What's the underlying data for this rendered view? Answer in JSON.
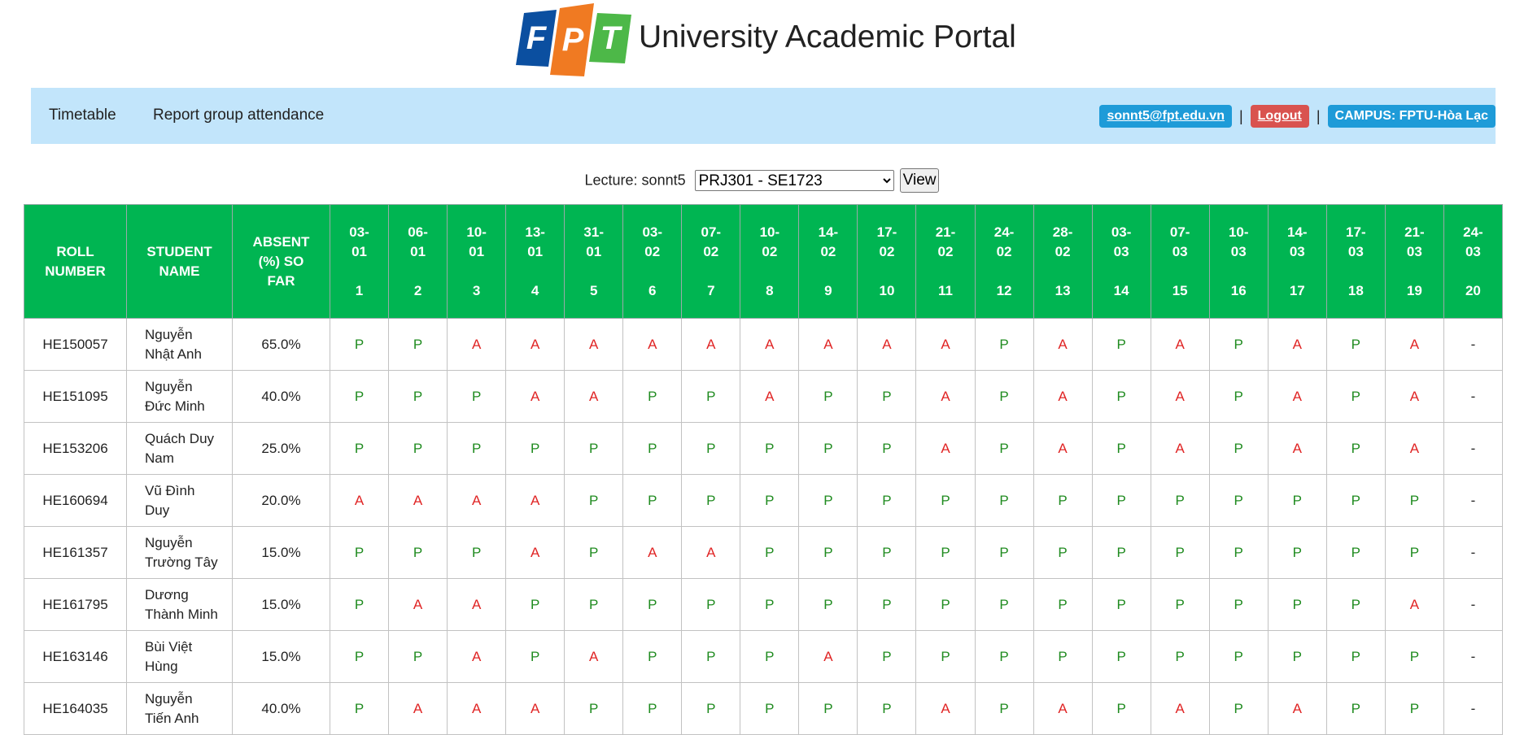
{
  "header": {
    "logo_text": "FPT",
    "title": "University Academic Portal"
  },
  "nav": {
    "timetable": "Timetable",
    "report": "Report group attendance",
    "email": "sonnt5@fpt.edu.vn",
    "separator": "|",
    "logout": "Logout",
    "campus": "CAMPUS: FPTU-Hòa Lạc"
  },
  "lecture_bar": {
    "label": "Lecture: sonnt5",
    "selected_course": "PRJ301 - SE1723",
    "view_button": "View"
  },
  "colors": {
    "present": "#1f8b1f",
    "absent": "#e02424",
    "header_bg": "#00b552",
    "nav_bg": "#c2e5fb"
  },
  "table": {
    "headers": {
      "roll": [
        "ROLL",
        "NUMBER"
      ],
      "student": [
        "STUDENT",
        "NAME"
      ],
      "absent": [
        "ABSENT",
        "(%) SO",
        "FAR"
      ]
    },
    "sessions": [
      {
        "date": [
          "03-",
          "01"
        ],
        "num": "1"
      },
      {
        "date": [
          "06-",
          "01"
        ],
        "num": "2"
      },
      {
        "date": [
          "10-",
          "01"
        ],
        "num": "3"
      },
      {
        "date": [
          "13-",
          "01"
        ],
        "num": "4"
      },
      {
        "date": [
          "31-",
          "01"
        ],
        "num": "5"
      },
      {
        "date": [
          "03-",
          "02"
        ],
        "num": "6"
      },
      {
        "date": [
          "07-",
          "02"
        ],
        "num": "7"
      },
      {
        "date": [
          "10-",
          "02"
        ],
        "num": "8"
      },
      {
        "date": [
          "14-",
          "02"
        ],
        "num": "9"
      },
      {
        "date": [
          "17-",
          "02"
        ],
        "num": "10"
      },
      {
        "date": [
          "21-",
          "02"
        ],
        "num": "11"
      },
      {
        "date": [
          "24-",
          "02"
        ],
        "num": "12"
      },
      {
        "date": [
          "28-",
          "02"
        ],
        "num": "13"
      },
      {
        "date": [
          "03-",
          "03"
        ],
        "num": "14"
      },
      {
        "date": [
          "07-",
          "03"
        ],
        "num": "15"
      },
      {
        "date": [
          "10-",
          "03"
        ],
        "num": "16"
      },
      {
        "date": [
          "14-",
          "03"
        ],
        "num": "17"
      },
      {
        "date": [
          "17-",
          "03"
        ],
        "num": "18"
      },
      {
        "date": [
          "21-",
          "03"
        ],
        "num": "19"
      },
      {
        "date": [
          "24-",
          "03"
        ],
        "num": "20"
      }
    ],
    "rows": [
      {
        "roll": "HE150057",
        "name": [
          "Nguyễn",
          "Nhật Anh"
        ],
        "absent": "65.0%",
        "att": [
          "P",
          "P",
          "A",
          "A",
          "A",
          "A",
          "A",
          "A",
          "A",
          "A",
          "A",
          "P",
          "A",
          "P",
          "A",
          "P",
          "A",
          "P",
          "A",
          "-"
        ]
      },
      {
        "roll": "HE151095",
        "name": [
          "Nguyễn",
          "Đức Minh"
        ],
        "absent": "40.0%",
        "att": [
          "P",
          "P",
          "P",
          "A",
          "A",
          "P",
          "P",
          "A",
          "P",
          "P",
          "A",
          "P",
          "A",
          "P",
          "A",
          "P",
          "A",
          "P",
          "A",
          "-"
        ]
      },
      {
        "roll": "HE153206",
        "name": [
          "Quách Duy",
          "Nam"
        ],
        "absent": "25.0%",
        "att": [
          "P",
          "P",
          "P",
          "P",
          "P",
          "P",
          "P",
          "P",
          "P",
          "P",
          "A",
          "P",
          "A",
          "P",
          "A",
          "P",
          "A",
          "P",
          "A",
          "-"
        ]
      },
      {
        "roll": "HE160694",
        "name": [
          "Vũ Đình",
          "Duy"
        ],
        "absent": "20.0%",
        "att": [
          "A",
          "A",
          "A",
          "A",
          "P",
          "P",
          "P",
          "P",
          "P",
          "P",
          "P",
          "P",
          "P",
          "P",
          "P",
          "P",
          "P",
          "P",
          "P",
          "-"
        ]
      },
      {
        "roll": "HE161357",
        "name": [
          "Nguyễn",
          "Trường Tây"
        ],
        "absent": "15.0%",
        "att": [
          "P",
          "P",
          "P",
          "A",
          "P",
          "A",
          "A",
          "P",
          "P",
          "P",
          "P",
          "P",
          "P",
          "P",
          "P",
          "P",
          "P",
          "P",
          "P",
          "-"
        ]
      },
      {
        "roll": "HE161795",
        "name": [
          "Dương",
          "Thành Minh"
        ],
        "absent": "15.0%",
        "att": [
          "P",
          "A",
          "A",
          "P",
          "P",
          "P",
          "P",
          "P",
          "P",
          "P",
          "P",
          "P",
          "P",
          "P",
          "P",
          "P",
          "P",
          "P",
          "A",
          "-"
        ]
      },
      {
        "roll": "HE163146",
        "name": [
          "Bùi Việt",
          "Hùng"
        ],
        "absent": "15.0%",
        "att": [
          "P",
          "P",
          "A",
          "P",
          "A",
          "P",
          "P",
          "P",
          "A",
          "P",
          "P",
          "P",
          "P",
          "P",
          "P",
          "P",
          "P",
          "P",
          "P",
          "-"
        ]
      },
      {
        "roll": "HE164035",
        "name": [
          "Nguyễn",
          "Tiến Anh"
        ],
        "absent": "40.0%",
        "att": [
          "P",
          "A",
          "A",
          "A",
          "P",
          "P",
          "P",
          "P",
          "P",
          "P",
          "A",
          "P",
          "A",
          "P",
          "A",
          "P",
          "A",
          "P",
          "P",
          "-"
        ]
      }
    ]
  }
}
